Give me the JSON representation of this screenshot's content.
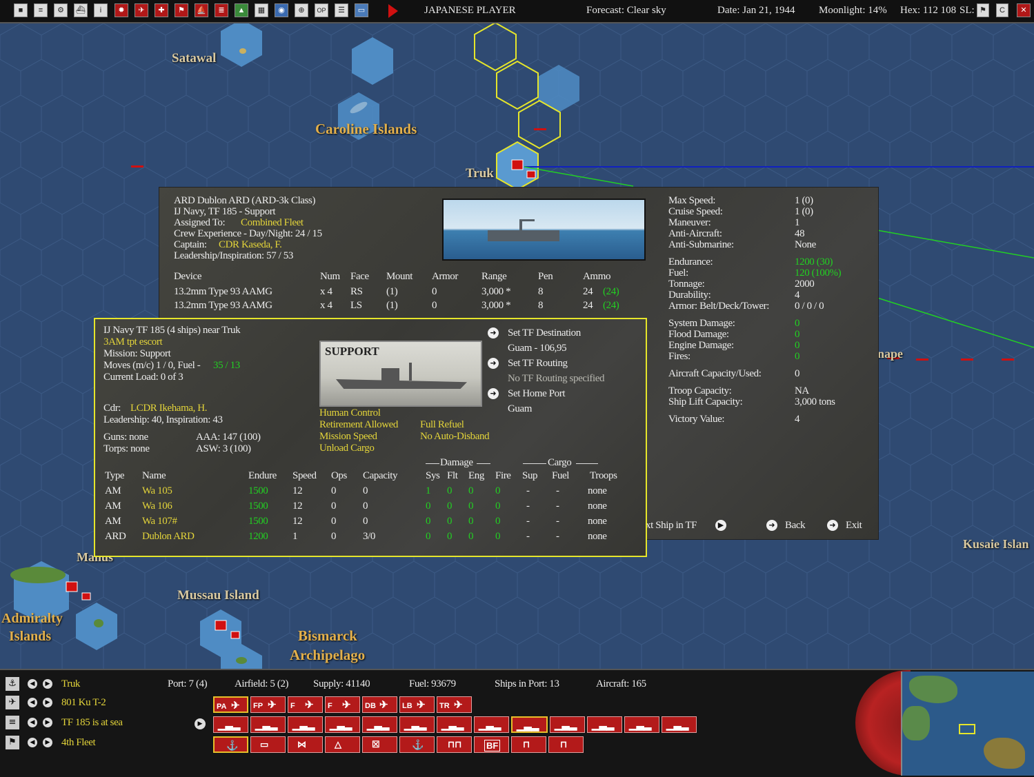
{
  "topbar": {
    "player": "JAPANESE PLAYER",
    "forecast": "Forecast: Clear sky",
    "date": "Date: Jan 21, 1944",
    "moonlight": "Moonlight: 14%",
    "hex": "Hex: 112 108",
    "sl": "SL:"
  },
  "map": {
    "satawal": "Satawal",
    "caroline": "Caroline Islands",
    "truk": "Truk",
    "manus": "Manus",
    "admiralty1": "Admiralty",
    "admiralty2": "Islands",
    "mussau": "Mussau Island",
    "bismarck1": "Bismarck",
    "bismarck2": "Archipelago",
    "kusaie": "Kusaie Islan",
    "ponape": "nape"
  },
  "ship": {
    "name": "ARD Dublon ARD (ARD-3k Class)",
    "navy": "IJ Navy, TF 185 - Support",
    "assigned_label": "Assigned To:",
    "assigned_value": "Combined Fleet",
    "crew": "Crew Experience - Day/Night: 24 / 15",
    "captain_label": "Captain:",
    "captain_value": "CDR Kaseda, F.",
    "leadership": "Leadership/Inspiration: 57 / 53",
    "device_headers": [
      "Device",
      "Num",
      "Face",
      "Mount",
      "Armor",
      "Range",
      "Pen",
      "Ammo"
    ],
    "devices": [
      {
        "device": "13.2mm Type 93 AAMG",
        "num": "x 4",
        "face": "RS",
        "mount": "(1)",
        "armor": "0",
        "range": "3,000 *",
        "pen": "8",
        "ammo": "24",
        "ammo2": "(24)"
      },
      {
        "device": "13.2mm Type 93 AAMG",
        "num": "x 4",
        "face": "LS",
        "mount": "(1)",
        "armor": "0",
        "range": "3,000 *",
        "pen": "8",
        "ammo": "24",
        "ammo2": "(24)"
      }
    ],
    "stats": {
      "max_speed_l": "Max Speed:",
      "max_speed": "1 (0)",
      "cruise_speed_l": "Cruise Speed:",
      "cruise_speed": "1 (0)",
      "maneuver_l": "Maneuver:",
      "maneuver": "1",
      "aa_l": "Anti-Aircraft:",
      "aa": "48",
      "asub_l": "Anti-Submarine:",
      "asub": "None",
      "endurance_l": "Endurance:",
      "endurance": "1200 (30)",
      "fuel_l": "Fuel:",
      "fuel": "120 (100%)",
      "tonnage_l": "Tonnage:",
      "tonnage": "2000",
      "durability_l": "Durability:",
      "durability": "4",
      "armor_l": "Armor: Belt/Deck/Tower:",
      "armor": "0 / 0 / 0",
      "sys_l": "System Damage:",
      "sys": "0",
      "flood_l": "Flood Damage:",
      "flood": "0",
      "engine_l": "Engine Damage:",
      "engine": "0",
      "fires_l": "Fires:",
      "fires": "0",
      "aircraft_l": "Aircraft Capacity/Used:",
      "aircraft": "0",
      "troop_l": "Troop Capacity:",
      "troop": "NA",
      "lift_l": "Ship Lift Capacity:",
      "lift": "3,000 tons",
      "victory_l": "Victory Value:",
      "victory": "4"
    },
    "next_ship": "xt Ship in TF",
    "back": "Back",
    "exit": "Exit"
  },
  "tf": {
    "title": "IJ Navy TF 185 (4 ships) near Truk",
    "escort": "3AM tpt escort",
    "mission": "Mission: Support",
    "moves": "Moves (m/c) 1 / 0, Fuel -",
    "moves_fuel": "35 / 13",
    "load": "Current Load: 0 of 3",
    "cdr_label": "Cdr:",
    "cdr_value": "LCDR Ikehama, H.",
    "leadership": "Leadership: 40, Inspiration: 43",
    "guns": "Guns: none",
    "aaa": "AAA: 147 (100)",
    "torps": "Torps: none",
    "asw": "ASW: 3 (100)",
    "image_label": "SUPPORT",
    "set_dest": "Set TF Destination",
    "dest_value": "Guam - 106,95",
    "set_routing": "Set TF Routing",
    "routing_value": "No TF Routing specified",
    "set_home": "Set Home Port",
    "home_value": "Guam",
    "opt_human": "Human Control",
    "opt_retire": "Retirement Allowed",
    "opt_refuel": "Full Refuel",
    "opt_mission_speed": "Mission Speed",
    "opt_no_disband": "No Auto-Disband",
    "opt_unload": "Unload Cargo",
    "damage_group": "Damage",
    "cargo_group": "Cargo",
    "headers": [
      "Type",
      "Name",
      "Endure",
      "Speed",
      "Ops",
      "Capacity",
      "Sys",
      "Flt",
      "Eng",
      "Fire",
      "Sup",
      "Fuel",
      "Troops"
    ],
    "rows": [
      {
        "type": "AM",
        "name": "Wa 105",
        "endure": "1500",
        "speed": "12",
        "ops": "0",
        "cap": "0",
        "sys": "1",
        "flt": "0",
        "eng": "0",
        "fire": "0",
        "sup": "-",
        "fuel": "-",
        "troops": "none"
      },
      {
        "type": "AM",
        "name": "Wa 106",
        "endure": "1500",
        "speed": "12",
        "ops": "0",
        "cap": "0",
        "sys": "0",
        "flt": "0",
        "eng": "0",
        "fire": "0",
        "sup": "-",
        "fuel": "-",
        "troops": "none"
      },
      {
        "type": "AM",
        "name": "Wa 107#",
        "endure": "1500",
        "speed": "12",
        "ops": "0",
        "cap": "0",
        "sys": "0",
        "flt": "0",
        "eng": "0",
        "fire": "0",
        "sup": "-",
        "fuel": "-",
        "troops": "none"
      },
      {
        "type": "ARD",
        "name": "Dublon ARD",
        "endure": "1200",
        "speed": "1",
        "ops": "0",
        "cap": "3/0",
        "sys": "0",
        "flt": "0",
        "eng": "0",
        "fire": "0",
        "sup": "-",
        "fuel": "-",
        "troops": "none"
      }
    ]
  },
  "bottom": {
    "base": "Truk",
    "port": "Port: 7 (4)",
    "airfield": "Airfield: 5 (2)",
    "supply": "Supply: 41140",
    "fuel": "Fuel: 93679",
    "ships_in_port": "Ships in Port: 13",
    "aircraft": "Aircraft: 165",
    "air_unit": "801 Ku T-2",
    "tf_unit": "TF 185 is at sea",
    "fleet": "4th Fleet",
    "air_buttons": [
      "PA",
      "FP",
      "F",
      "F",
      "DB",
      "LB",
      "TR"
    ],
    "bf_label": "BF"
  },
  "colors": {
    "accent_yellow": "#e6e62a",
    "green_value": "#22d022",
    "gold_label": "#e3b04b",
    "red_button": "#b31a1a"
  }
}
